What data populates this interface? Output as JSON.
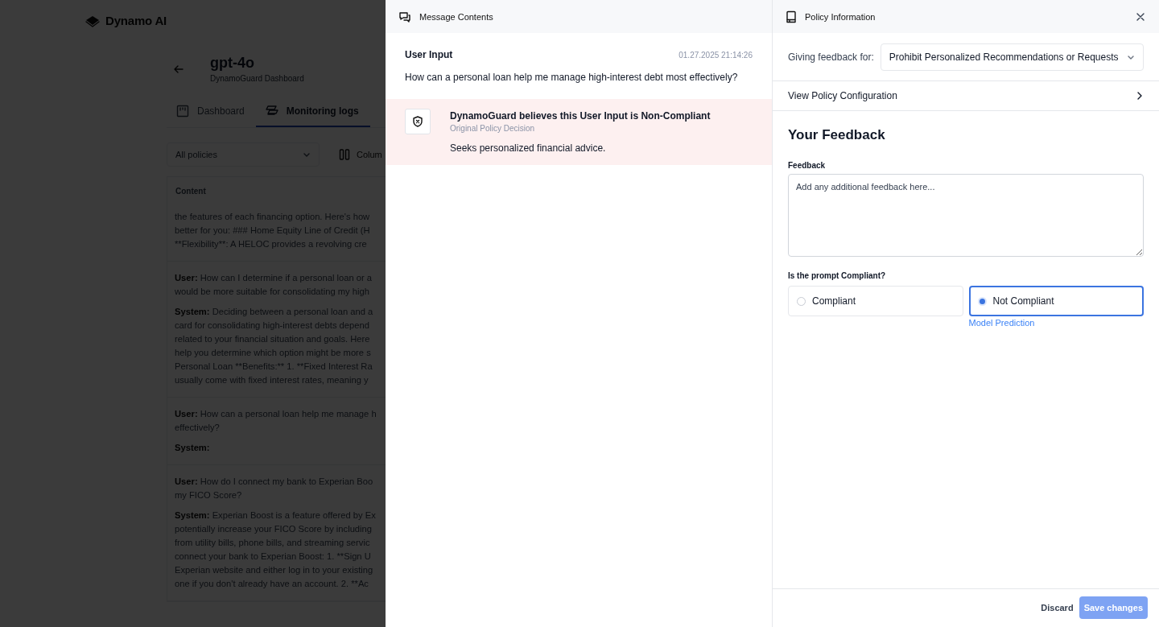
{
  "app": {
    "logo": "Dynamo AI"
  },
  "page": {
    "title": "gpt-4o",
    "subtitle": "DynamoGuard Dashboard",
    "tabs": [
      {
        "label": "Dashboard",
        "kind": "dashboard",
        "selected": false
      },
      {
        "label": "Monitoring logs",
        "kind": "logs",
        "selected": true
      }
    ],
    "policy_filter": {
      "placeholder": "All policies"
    },
    "columns_button": "Colum",
    "table": {
      "column": "Content",
      "rows": [
        {
          "paragraphs": [
            {
              "lines": [
                {
                  "text": "the features of each financing option. Here's how"
                },
                {
                  "text": "better for you: ### Home Equity Line of Credit (H"
                },
                {
                  "text": "**Flexibility**: A HELOC provides a revolving cre"
                }
              ]
            }
          ]
        },
        {
          "paragraphs": [
            {
              "lines": [
                {
                  "speaker": "User:",
                  "text": "How can I determine if a personal loan or a"
                },
                {
                  "text": "would be more suitable for consolidating my high"
                }
              ]
            },
            {
              "lines": [
                {
                  "speaker": "System:",
                  "text": "Deciding between a personal loan and a"
                },
                {
                  "text": "card for consolidating high-interest debts depend"
                },
                {
                  "text": "related to your financial situation and goals. Here"
                },
                {
                  "text": "help you determine which option might be more s"
                },
                {
                  "text": "Personal Loan **Benefits:** 1. **Fixed Interest Ra"
                },
                {
                  "text": "usually come with fixed interest rates, meaning y"
                }
              ]
            }
          ]
        },
        {
          "paragraphs": [
            {
              "lines": [
                {
                  "speaker": "User:",
                  "text": "How can a personal loan help me manage h"
                },
                {
                  "text": "effectively?"
                }
              ]
            },
            {
              "lines": [
                {
                  "speaker": "System:"
                }
              ]
            }
          ]
        },
        {
          "paragraphs": [
            {
              "lines": [
                {
                  "speaker": "User:",
                  "text": "How do I connect my bank to Experian Boo"
                },
                {
                  "text": "my FICO Score?"
                }
              ]
            },
            {
              "lines": [
                {
                  "speaker": "System:",
                  "text": "Experian Boost is a feature offered by Ex"
                },
                {
                  "text": "potentially increase your FICO Score by including"
                },
                {
                  "text": "from utility bills, phone bills, and streaming servic"
                },
                {
                  "text": "connect your bank to Experian Boost: 1. **Sign U"
                },
                {
                  "text": "Experian website and either log in to your existing"
                },
                {
                  "text": "one if you don't already have an account. 2. **Ac"
                }
              ]
            }
          ]
        }
      ]
    }
  },
  "message_panel": {
    "title": "Message Contents",
    "source": "User Input",
    "timestamp": "01.27.2025 21:14:26",
    "message": "How can a personal loan help me manage high-interest debt most effectively?",
    "decision": {
      "compliant": false,
      "headline": "DynamoGuard believes this User Input is Non-Compliant",
      "caption": "Original Policy Decision",
      "reason": "Seeks personalized financial advice."
    }
  },
  "policy_panel": {
    "title": "Policy Information",
    "feedback_for_label": "Giving feedback for:",
    "policy": "Prohibit Personalized Recommendations or Requests",
    "config_link": "View Policy Configuration",
    "heading": "Your Feedback",
    "feedback_label": "Feedback",
    "feedback_placeholder": "Add any additional feedback here...",
    "question": "Is the prompt Compliant?",
    "options": [
      {
        "label": "Compliant",
        "selected": false
      },
      {
        "label": "Not Compliant",
        "selected": true,
        "note": "Model Prediction"
      }
    ],
    "discard": "Discard",
    "save": {
      "label": "Save changes",
      "disabled": true
    }
  }
}
